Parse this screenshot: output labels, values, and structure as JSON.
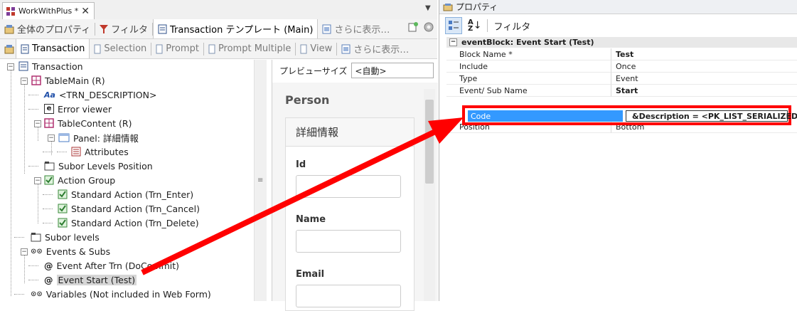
{
  "document_tab": {
    "title": "WorkWithPlus *",
    "close": "✕"
  },
  "toolbar1": {
    "items": [
      "全体のプロパティ",
      "フィルタ",
      "Transaction テンプレート (Main)",
      "さらに表示…"
    ]
  },
  "toolbar2": {
    "items": [
      "Transaction",
      "Selection",
      "Prompt",
      "Prompt Multiple",
      "View",
      "さらに表示…"
    ]
  },
  "tree": {
    "transaction": "Transaction",
    "table_main": "TableMain (R)",
    "trn_description": "<TRN_DESCRIPTION>",
    "error_viewer": "Error viewer",
    "table_content": "TableContent (R)",
    "panel": "Panel: 詳細情報",
    "attributes": "Attributes",
    "subor_levels_position": "Subor Levels Position",
    "action_group": "Action Group",
    "action_enter": "Standard Action (Trn_Enter)",
    "action_cancel": "Standard Action (Trn_Cancel)",
    "action_delete": "Standard Action (Trn_Delete)",
    "subor_levels": "Subor levels",
    "events_subs": "Events & Subs",
    "event_after_trn": "Event After Trn (DoCommit)",
    "event_start": "Event Start (Test)",
    "variables": "Variables (Not included in Web Form)"
  },
  "preview": {
    "size_label": "プレビューサイズ",
    "size_value": "<自動>",
    "title": "Person",
    "card_header": "詳細情報",
    "fields": [
      "Id",
      "Name",
      "Email"
    ]
  },
  "properties": {
    "title": "プロパティ",
    "filter_label": "フィルタ",
    "category": "eventBlock: Event Start (Test)",
    "rows": [
      {
        "name": "Block Name *",
        "value": "Test",
        "bold": true
      },
      {
        "name": "Include",
        "value": "Once",
        "bold": false
      },
      {
        "name": "Type",
        "value": "Event",
        "bold": false
      },
      {
        "name": "Event/ Sub Name",
        "value": "Start",
        "bold": true
      },
      {
        "name": "Code",
        "value": "&Description = <PK_LIST_SERIALIZED>",
        "bold": true
      },
      {
        "name": "Position",
        "value": "Bottom",
        "bold": false
      }
    ]
  },
  "colors": {
    "annotation_red": "#ff0000",
    "selection_blue": "#3399ff"
  }
}
